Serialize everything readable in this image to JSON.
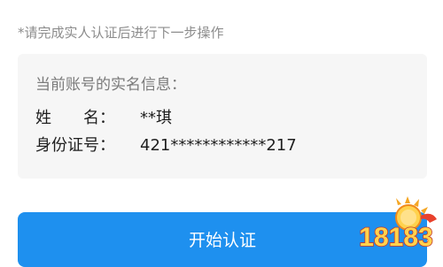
{
  "notice": {
    "text": "*请完成实人认证后进行下一步操作"
  },
  "info_card": {
    "heading": "当前账号的实名信息：",
    "name_label": "姓　　名：",
    "name_value": "**琪",
    "id_label": "身份证号：",
    "id_value": "421************217"
  },
  "primary_button": {
    "label": "开始认证",
    "color": "#1e90ef"
  },
  "watermark": {
    "text": "18183",
    "icon": "18183-logo-icon"
  },
  "colors": {
    "card_background": "#f6f6f6",
    "notice_text": "#8c8c8c",
    "heading_text": "#7a7a7a",
    "body_text": "#1f1f1f"
  }
}
